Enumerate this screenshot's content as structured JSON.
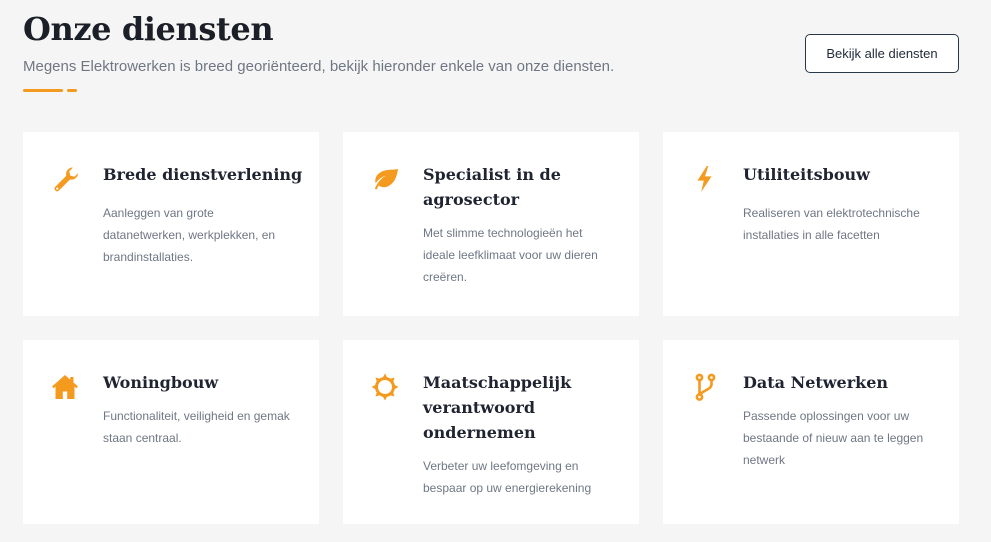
{
  "header": {
    "title": "Onze diensten",
    "subtitle": "Megens Elektrowerken is breed georiënteerd, bekijk hieronder enkele van onze diensten.",
    "button_label": "Bekijk alle diensten"
  },
  "colors": {
    "accent": "#f39a1f",
    "button_border": "#293747",
    "background": "#f5f5f5",
    "card": "#ffffff"
  },
  "services": [
    {
      "title": "Brede dienstverlening",
      "description": "Aanleggen van grote datanetwerken, werkplekken, en brandinstallaties.",
      "icon": "wrench-icon"
    },
    {
      "title": "Specialist in de agrosector",
      "description": "Met slimme technologieën het ideale leefklimaat voor uw dieren creëren.",
      "icon": "leaf-icon"
    },
    {
      "title": "Utiliteitsbouw",
      "description": "Realiseren van elektrotechnische installaties in alle facetten",
      "icon": "lightning-icon"
    },
    {
      "title": "Woningbouw",
      "description": "Functionaliteit, veiligheid en gemak staan centraal.",
      "icon": "house-icon"
    },
    {
      "title": "Maatschappelijk verantwoord ondernemen",
      "description": "Verbeter uw leefomgeving en bespaar op uw energierekening",
      "icon": "sun-icon"
    },
    {
      "title": "Data Netwerken",
      "description": "Passende oplossingen voor uw bestaande of nieuw aan te leggen netwerk",
      "icon": "branch-icon"
    }
  ]
}
